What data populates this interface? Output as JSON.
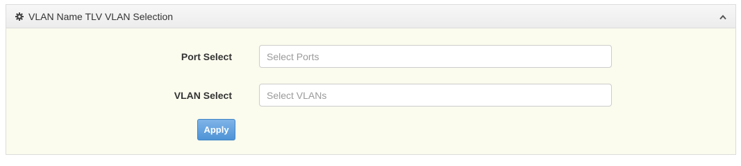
{
  "panel": {
    "title": "VLAN Name TLV VLAN Selection",
    "header_icon": "gear-icon",
    "collapse_icon": "chevron-up-icon"
  },
  "form": {
    "port_select": {
      "label": "Port Select",
      "value": "",
      "placeholder": "Select Ports"
    },
    "vlan_select": {
      "label": "VLAN Select",
      "value": "",
      "placeholder": "Select VLANs"
    },
    "apply_label": "Apply"
  },
  "colors": {
    "panel_background": "#fbfbee",
    "header_background": "#ececec",
    "apply_button": "#5b9bd9"
  }
}
